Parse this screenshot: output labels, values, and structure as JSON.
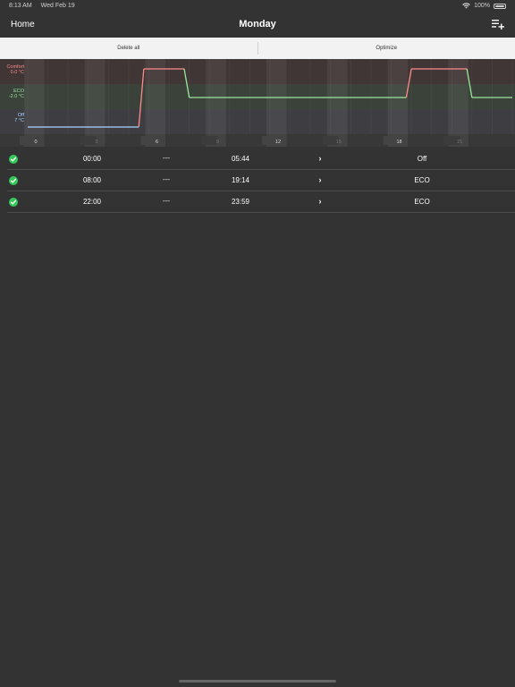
{
  "status_bar": {
    "time": "8:13 AM",
    "date": "Wed Feb 19",
    "battery": "100%"
  },
  "nav": {
    "back_label": "Home",
    "title": "Monday",
    "add_icon": "list-add-icon"
  },
  "toolbar": {
    "delete_all": "Delete all",
    "optimize": "Optimize"
  },
  "chart": {
    "levels": [
      {
        "name": "Comfort",
        "value": "0.0 °C",
        "color": "#ff8a8a"
      },
      {
        "name": "ECO",
        "value": "-2.0 °C",
        "color": "#9be79b"
      },
      {
        "name": "Off",
        "value": "7 °C",
        "color": "#a9d4ff"
      }
    ],
    "hour_labels": [
      "0",
      "3",
      "6",
      "9",
      "12",
      "15",
      "18",
      "21"
    ]
  },
  "chart_data": {
    "type": "line",
    "title": "",
    "xlabel": "",
    "ylabel": "",
    "xlim": [
      0,
      24
    ],
    "y_categories": [
      "Off",
      "ECO",
      "Comfort"
    ],
    "series": [
      {
        "color": "#a9d4ff",
        "points": [
          [
            0,
            "Off"
          ],
          [
            5.5,
            "Off"
          ]
        ]
      },
      {
        "color": "#ff8a8a",
        "points": [
          [
            5.75,
            "Comfort"
          ],
          [
            7.75,
            "Comfort"
          ]
        ]
      },
      {
        "color": "#9be79b",
        "points": [
          [
            8.0,
            "ECO"
          ],
          [
            18.75,
            "ECO"
          ]
        ]
      },
      {
        "color": "#ff8a8a",
        "points": [
          [
            19.0,
            "Comfort"
          ],
          [
            21.75,
            "Comfort"
          ]
        ]
      },
      {
        "color": "#9be79b",
        "points": [
          [
            22.0,
            "ECO"
          ],
          [
            24,
            "ECO"
          ]
        ]
      }
    ],
    "ticks": [
      "0",
      "3",
      "6",
      "9",
      "12",
      "15",
      "18",
      "21"
    ]
  },
  "schedule": [
    {
      "start": "00:00",
      "end": "05:44",
      "mode": "Off"
    },
    {
      "start": "08:00",
      "end": "19:14",
      "mode": "ECO"
    },
    {
      "start": "22:00",
      "end": "23:59",
      "mode": "ECO"
    }
  ],
  "list_separator": "—",
  "colors": {
    "background": "#333333",
    "toolbar": "#f2f2f2",
    "check": "#34c759"
  }
}
